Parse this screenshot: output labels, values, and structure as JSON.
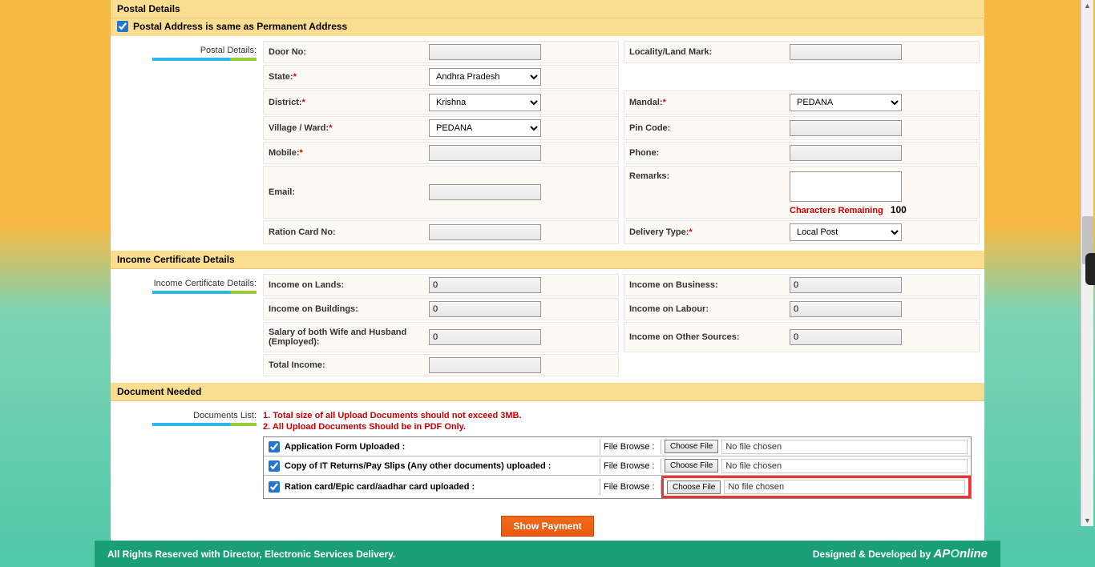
{
  "sections": {
    "postal_header": "Postal Details",
    "same_address_label": "Postal Address is same as Permanent Address",
    "postal_side_label": "Postal Details:",
    "income_header": "Income Certificate Details",
    "income_side_label": "Income Certificate Details:",
    "doc_header": "Document Needed",
    "doc_side_label": "Documents List:"
  },
  "postal": {
    "door_no_label": "Door No:",
    "door_no_value": "",
    "locality_label": "Locality/Land Mark:",
    "locality_value": "",
    "state_label": "State:",
    "state_value": "Andhra Pradesh",
    "district_label": "District:",
    "district_value": "Krishna",
    "mandal_label": "Mandal:",
    "mandal_value": "PEDANA",
    "village_label": "Village / Ward:",
    "village_value": "PEDANA",
    "pincode_label": "Pin Code:",
    "pincode_value": "",
    "mobile_label": "Mobile:",
    "mobile_value": "",
    "phone_label": "Phone:",
    "phone_value": "",
    "email_label": "Email:",
    "email_value": "",
    "remarks_label": "Remarks:",
    "remarks_value": "",
    "remarks_note": "Characters Remaining",
    "remarks_count": "100",
    "ration_label": "Ration Card No:",
    "ration_value": "",
    "delivery_label": "Delivery Type:",
    "delivery_value": "Local Post"
  },
  "income": {
    "lands_label": "Income on Lands:",
    "business_label": "Income on Business:",
    "buildings_label": "Income on Buildings:",
    "labour_label": "Income on Labour:",
    "salary_label": "Salary of both Wife and Husband (Employed):",
    "other_label": "Income on Other Sources:",
    "total_label": "Total Income:",
    "zero": "0"
  },
  "documents": {
    "warn1": "1. Total size of all Upload Documents should not exceed 3MB.",
    "warn2": "2. All Upload Documents Should be in PDF Only.",
    "row1_label": "Application Form Uploaded :",
    "row2_label": "Copy of IT Returns/Pay Slips (Any other documents) uploaded :",
    "row3_label": "Ration card/Epic card/aadhar card uploaded :",
    "browse_label": "File Browse :",
    "choose_file": "Choose File",
    "no_file": "No file chosen"
  },
  "buttons": {
    "show_payment": "Show Payment"
  },
  "footer": {
    "left": "All Rights Reserved with Director, Electronic Services Delivery.",
    "right_prefix": "Designed & Developed by ",
    "logo_ap": "AP",
    "logo_on": "O",
    "logo_nline": "nline"
  }
}
